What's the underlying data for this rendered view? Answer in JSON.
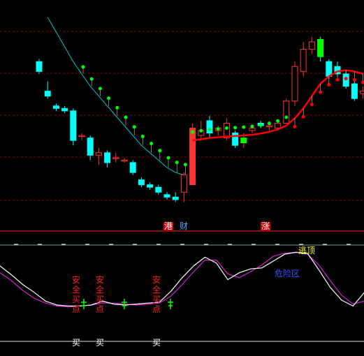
{
  "colors": {
    "background": "#000000",
    "up": "#ff3333",
    "down": "#00ffff",
    "signal_green": "#00ff00",
    "dot_green": "#00ff00",
    "dot_red": "#ff0000",
    "ma_line": "#ff0000",
    "ma_line_cyan": "#00c8c8",
    "grid": "#8b0000",
    "divider": "#ff2020",
    "k_line": "#ffffff",
    "d_line": "#d020d0",
    "label_red": "#ff2020",
    "label_blue": "#3355ff",
    "label_yellow": "#ffff00",
    "label_white": "#ffffff"
  },
  "markers": {
    "gang": "港",
    "cai": "财",
    "zhang": "涨"
  },
  "signals": {
    "safe_buy_text": [
      "安",
      "全",
      "买",
      "点"
    ],
    "buy_label": "买",
    "danger_zone": "危险区",
    "escape_top": "逃顶"
  },
  "chart_data": {
    "type": "candlestick",
    "main_panel": {
      "candles": [
        {
          "o": 100,
          "h": 101,
          "l": 95,
          "c": 96
        },
        {
          "o": 88,
          "h": 92,
          "l": 85,
          "c": 86
        },
        {
          "o": 82,
          "h": 83,
          "l": 80,
          "c": 81
        },
        {
          "o": 81,
          "h": 82,
          "l": 79,
          "c": 80
        },
        {
          "o": 80,
          "h": 81,
          "l": 66,
          "c": 68
        },
        {
          "o": 70,
          "h": 71,
          "l": 68,
          "c": 70
        },
        {
          "o": 69,
          "h": 70,
          "l": 60,
          "c": 62
        },
        {
          "o": 62,
          "h": 65,
          "l": 58,
          "c": 63
        },
        {
          "o": 63,
          "h": 64,
          "l": 57,
          "c": 59
        },
        {
          "o": 61,
          "h": 63,
          "l": 59,
          "c": 61
        },
        {
          "o": 60,
          "h": 61,
          "l": 59,
          "c": 60
        },
        {
          "o": 59,
          "h": 60,
          "l": 54,
          "c": 55
        },
        {
          "o": 52,
          "h": 53,
          "l": 49,
          "c": 50
        },
        {
          "o": 50,
          "h": 51,
          "l": 48,
          "c": 49
        },
        {
          "o": 49,
          "h": 50,
          "l": 46,
          "c": 47
        },
        {
          "o": 46,
          "h": 47,
          "l": 44,
          "c": 45
        },
        {
          "o": 45,
          "h": 47,
          "l": 43,
          "c": 44
        },
        {
          "o": 47,
          "h": 55,
          "l": 43,
          "c": 54
        },
        {
          "o": 50,
          "h": 75,
          "l": 50,
          "c": 73
        },
        {
          "o": 70,
          "h": 76,
          "l": 68,
          "c": 72
        },
        {
          "o": 76,
          "h": 78,
          "l": 69,
          "c": 71
        },
        {
          "o": 72,
          "h": 74,
          "l": 70,
          "c": 73
        },
        {
          "o": 69,
          "h": 77,
          "l": 68,
          "c": 75
        },
        {
          "o": 71,
          "h": 72,
          "l": 65,
          "c": 66
        },
        {
          "o": 67,
          "h": 71,
          "l": 65,
          "c": 69
        },
        {
          "o": 72,
          "h": 74,
          "l": 71,
          "c": 73
        },
        {
          "o": 75,
          "h": 76,
          "l": 73,
          "c": 74
        },
        {
          "o": 74,
          "h": 76,
          "l": 72,
          "c": 74
        },
        {
          "o": 73,
          "h": 76,
          "l": 72,
          "c": 75
        },
        {
          "o": 75,
          "h": 85,
          "l": 75,
          "c": 84
        },
        {
          "o": 84,
          "h": 100,
          "l": 82,
          "c": 98
        },
        {
          "o": 96,
          "h": 108,
          "l": 94,
          "c": 105
        },
        {
          "o": 105,
          "h": 110,
          "l": 103,
          "c": 108
        },
        {
          "o": 109,
          "h": 110,
          "l": 100,
          "c": 102
        },
        {
          "o": 100,
          "h": 101,
          "l": 93,
          "c": 94
        },
        {
          "o": 98,
          "h": 100,
          "l": 94,
          "c": 95
        },
        {
          "o": 95,
          "h": 96,
          "l": 89,
          "c": 90
        },
        {
          "o": 91,
          "h": 92,
          "l": 84,
          "c": 85
        },
        {
          "o": 87,
          "h": 90,
          "l": 85,
          "c": 88
        }
      ],
      "ma_red": [
        null,
        null,
        null,
        null,
        null,
        null,
        null,
        null,
        null,
        null,
        null,
        null,
        null,
        null,
        null,
        null,
        null,
        null,
        68,
        68.5,
        69,
        69.3,
        69.6,
        69.8,
        70,
        70.3,
        70.8,
        71.5,
        72.5,
        74,
        77,
        81,
        86,
        91,
        94,
        96,
        96.5,
        96,
        95
      ],
      "ma_cyan": [
        null,
        118,
        112,
        106,
        100,
        95,
        90,
        86,
        82,
        78,
        74,
        70,
        66,
        63,
        60,
        57,
        55,
        54
      ]
    },
    "indicator_panel": {
      "k": [
        85,
        76,
        66,
        58,
        49,
        45,
        44,
        44,
        45,
        49,
        46,
        45,
        46,
        47,
        48,
        59,
        73,
        85,
        94,
        88,
        71,
        78,
        82,
        83,
        90,
        97,
        99,
        98,
        81,
        63,
        50,
        44,
        58
      ],
      "d": [
        78,
        70,
        60,
        52,
        47,
        44,
        43,
        44,
        45,
        47,
        47,
        46,
        45,
        46,
        47,
        54,
        66,
        79,
        91,
        91,
        77,
        73,
        79,
        86,
        95,
        98,
        99,
        97,
        86,
        70,
        55,
        46,
        49
      ]
    }
  }
}
